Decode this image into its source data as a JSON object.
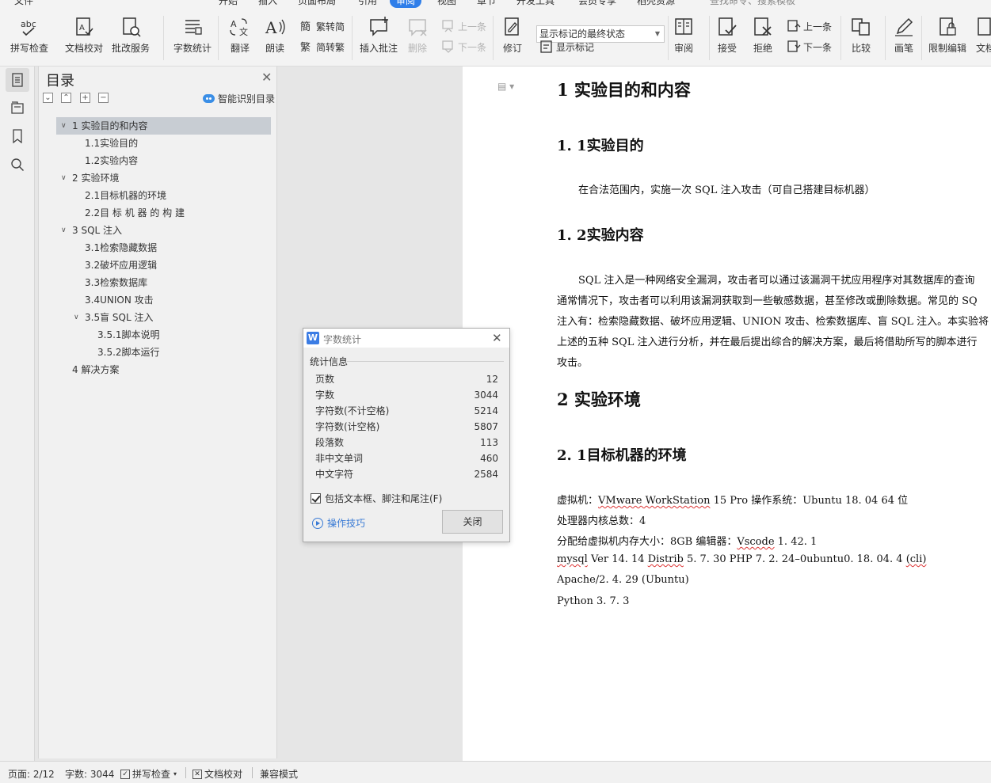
{
  "menubar": {
    "items": [
      "文件",
      "开始",
      "插入",
      "页面布局",
      "引用",
      "审阅",
      "视图",
      "章节",
      "开发工具",
      "会员专享",
      "稻壳资源"
    ],
    "active": "审阅",
    "search_placeholder": "查找命令、搜索模板"
  },
  "ribbon": {
    "spell_check": "拼写检查",
    "doc_proof": "文档校对",
    "revision_service": "批改服务",
    "word_count": "字数统计",
    "translate": "翻译",
    "read_aloud": "朗读",
    "trad_to_simp": "繁转简",
    "simp_to_trad": "简转繁",
    "insert_comment": "插入批注",
    "delete": "删除",
    "prev_comment": "上一条",
    "next_comment": "下一条",
    "track_changes": "修订",
    "markup_mode": "显示标记的最终状态",
    "show_markup": "显示标记",
    "review": "审阅",
    "accept": "接受",
    "reject": "拒绝",
    "prev_change": "上一条",
    "next_change": "下一条",
    "compare": "比较",
    "pen": "画笔",
    "restrict_editing": "限制编辑",
    "doc_rights": "文档"
  },
  "toc": {
    "title": "目录",
    "smart": "智能识别目录",
    "items": [
      {
        "label": "1 实验目的和内容",
        "level": 1,
        "expanded": true
      },
      {
        "label": "1.1实验目的",
        "level": 2
      },
      {
        "label": "1.2实验内容",
        "level": 2
      },
      {
        "label": "2 实验环境",
        "level": 1,
        "expanded": true
      },
      {
        "label": "2.1目标机器的环境",
        "level": 2
      },
      {
        "label": "2.2目 标 机 器 的 构 建",
        "level": 2
      },
      {
        "label": "3 SQL 注入",
        "level": 1,
        "expanded": true
      },
      {
        "label": "3.1检索隐藏数据",
        "level": 2
      },
      {
        "label": "3.2破坏应用逻辑",
        "level": 2
      },
      {
        "label": "3.3检索数据库",
        "level": 2
      },
      {
        "label": "3.4UNION 攻击",
        "level": 2
      },
      {
        "label": "3.5盲 SQL 注入",
        "level": 2,
        "expanded": true
      },
      {
        "label": "3.5.1脚本说明",
        "level": 3
      },
      {
        "label": "3.5.2脚本运行",
        "level": 3
      },
      {
        "label": "4 解决方案",
        "level": 1
      }
    ]
  },
  "document": {
    "h1_1": "1  实验目的和内容",
    "h2_1_1": "1. 1实验目的",
    "p_1_1": "在合法范围内，实施一次 SQL 注入攻击（可自己搭建目标机器）",
    "h2_1_2": "1. 2实验内容",
    "p_1_2_a": "SQL 注入是一种网络安全漏洞，攻击者可以通过该漏洞干扰应用程序对其数据库的查询",
    "p_1_2_b": "通常情况下，攻击者可以利用该漏洞获取到一些敏感数据，甚至修改或删除数据。常见的 SQ",
    "p_1_2_c": "注入有：检索隐藏数据、破坏应用逻辑、UNION 攻击、检索数据库、盲 SQL 注入。本实验将",
    "p_1_2_d": "上述的五种 SQL 注入进行分析，并在最后提出综合的解决方案，最后将借助所写的脚本进行",
    "p_1_2_e": "攻击。",
    "h1_2": "2  实验环境",
    "h2_2_1": "2. 1目标机器的环境",
    "env_vm_label": "虚拟机：",
    "env_vm_value": "VMware WorkStation",
    "env_vm_rest": " 15  Pro 操作系统：Ubuntu 18. 04  64 位",
    "env_cores": "处理器内核总数：4",
    "env_mem_a": "分配给虚拟机内存大小：8GB 编辑器：",
    "env_mem_editor": "Vscode",
    "env_mem_b": " 1. 42. 1",
    "env_mysql_a": "mysql",
    "env_mysql_b": "  Ver  14. 14  ",
    "env_mysql_c": "Distrib",
    "env_mysql_d": "  5. 7. 30 PHP 7. 2. 24–0ubuntu0. 18. 04. 4 ",
    "env_mysql_e": "(cli)",
    "env_apache": "Apache/2. 4. 29 (Ubuntu)",
    "env_python": "Python 3. 7. 3"
  },
  "dialog": {
    "title": "字数统计",
    "section": "统计信息",
    "stats": [
      {
        "label": "页数",
        "value": "12"
      },
      {
        "label": "字数",
        "value": "3044"
      },
      {
        "label": "字符数(不计空格)",
        "value": "5214"
      },
      {
        "label": "字符数(计空格)",
        "value": "5807"
      },
      {
        "label": "段落数",
        "value": "113"
      },
      {
        "label": "非中文单词",
        "value": "460"
      },
      {
        "label": "中文字符",
        "value": "2584"
      }
    ],
    "include_label": "包括文本框、脚注和尾注(F)",
    "include_checked": true,
    "tips": "操作技巧",
    "close": "关闭"
  },
  "status": {
    "page": "页面: 2/12",
    "words": "字数: 3044",
    "spell": "拼写检查",
    "proof": "文档校对",
    "compat": "兼容模式"
  },
  "colors": {
    "accent": "#2f7ee9",
    "toc_selected": "#c8cdd3",
    "spell_error": "#d33333"
  }
}
